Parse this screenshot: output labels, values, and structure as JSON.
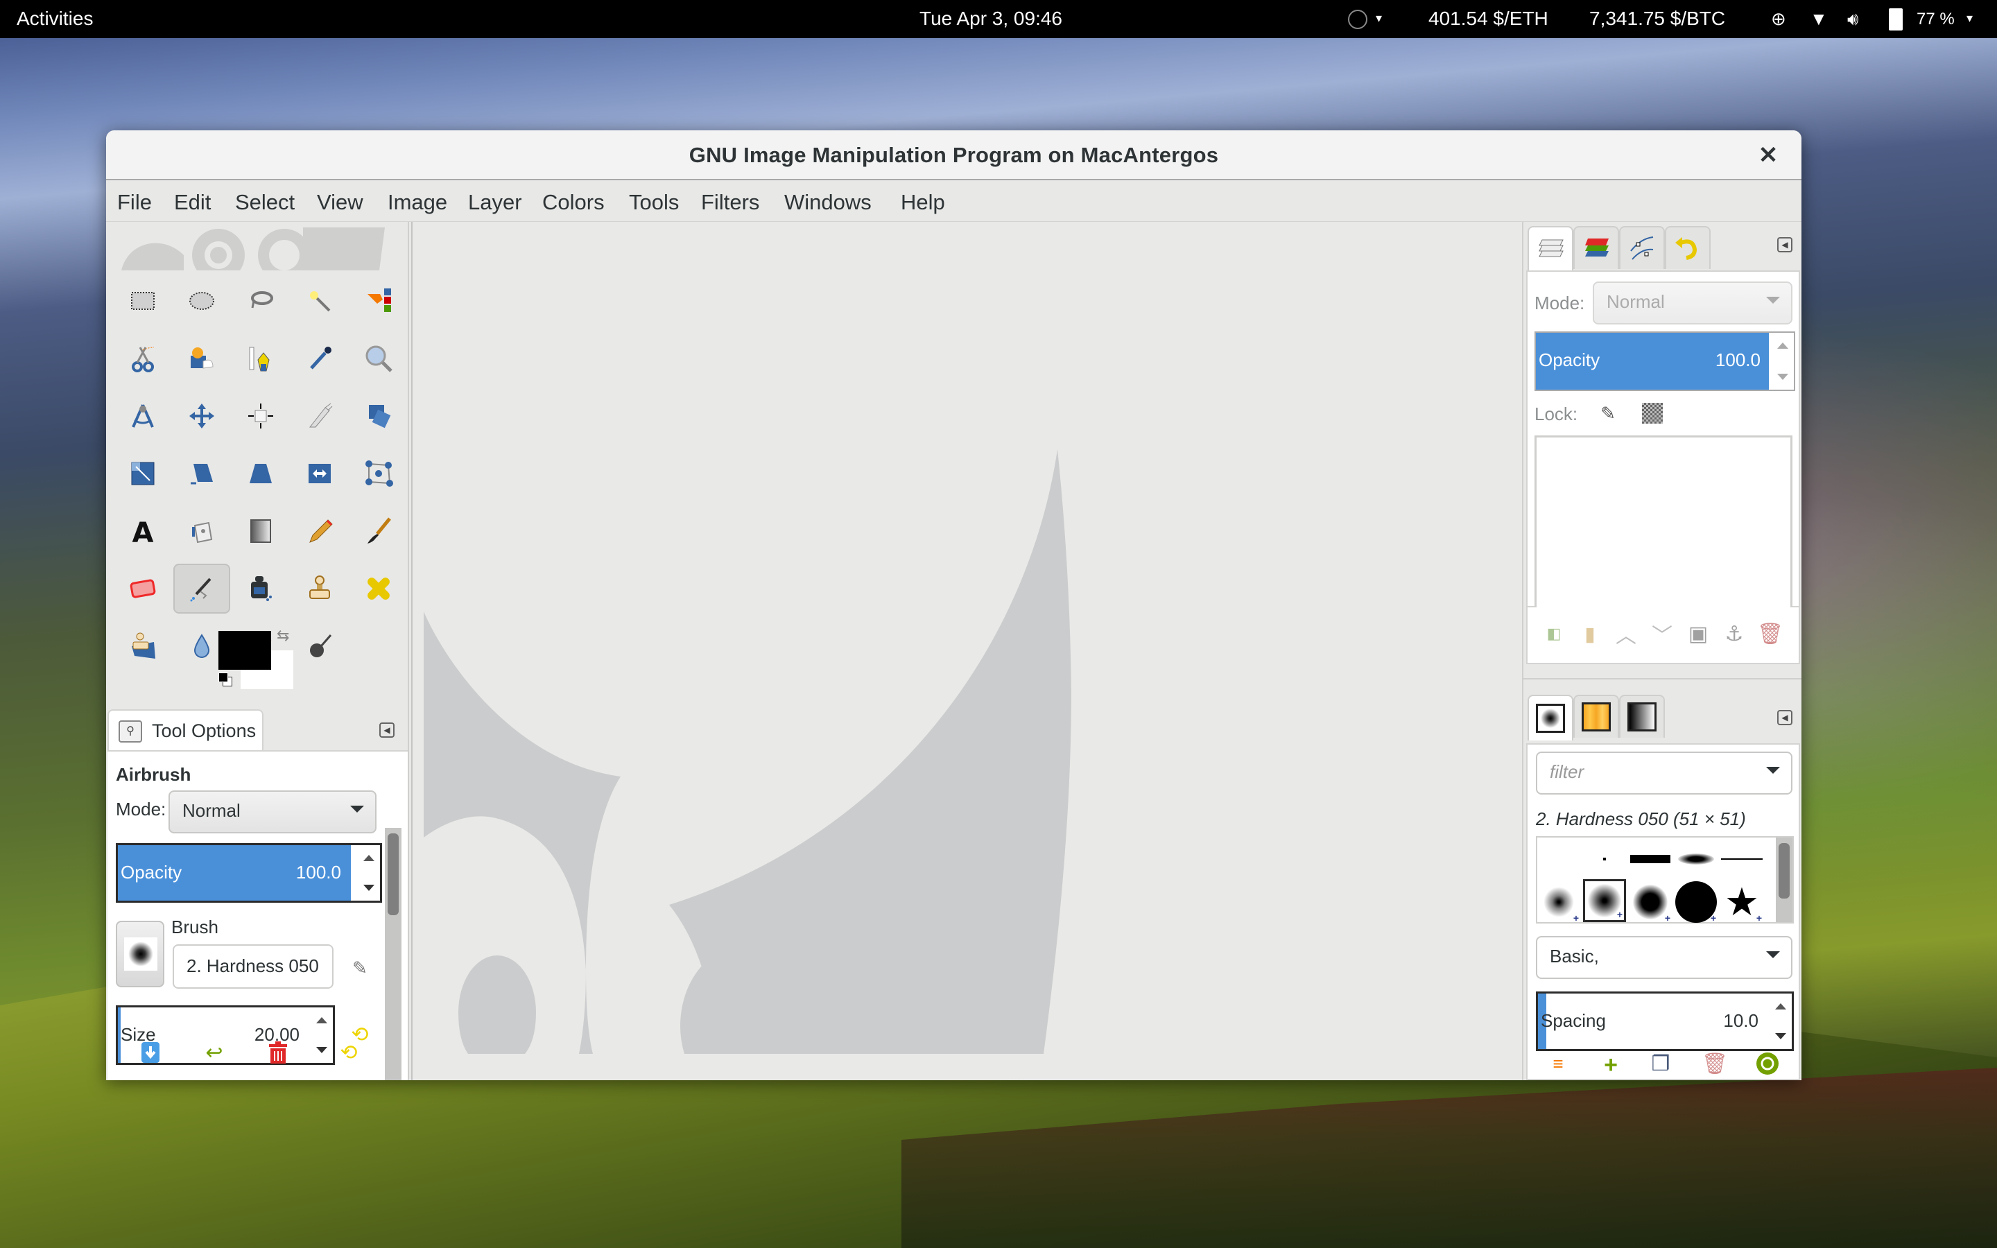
{
  "topbar": {
    "activities": "Activities",
    "clock": "Tue Apr  3, 09:46",
    "eth": "401.54 $/ETH",
    "btc": "7,341.75 $/BTC",
    "battery": "77 %",
    "caret": "▾",
    "icons": [
      "status-circle-icon",
      "accessibility-icon",
      "wifi-icon",
      "volume-icon",
      "battery-icon"
    ]
  },
  "window": {
    "title": "GNU Image Manipulation Program on MacAntergos",
    "close": "✕"
  },
  "menu": [
    "File",
    "Edit",
    "Select",
    "View",
    "Image",
    "Layer",
    "Colors",
    "Tools",
    "Filters",
    "Windows",
    "Help"
  ],
  "toolbox": {
    "tools": [
      "rect-select",
      "ellipse-select",
      "free-select",
      "fuzzy-select",
      "select-by-color",
      "scissors-select",
      "foreground-select",
      "paths",
      "color-picker",
      "zoom",
      "measure",
      "move",
      "alignment",
      "crop",
      "rotate",
      "scale",
      "shear",
      "perspective",
      "flip",
      "cage-transform",
      "text",
      "bucket-fill",
      "blend",
      "pencil",
      "paintbrush",
      "eraser",
      "airbrush",
      "ink",
      "clone",
      "heal",
      "perspective-clone",
      "blur-sharpen",
      "smudge",
      "dodge-burn"
    ],
    "active_tool": "airbrush",
    "foreground_color": "#000000",
    "background_color": "#ffffff"
  },
  "tool_options": {
    "tab_label": "Tool Options",
    "tool_name": "Airbrush",
    "mode_label": "Mode:",
    "mode_value": "Normal",
    "opacity_label": "Opacity",
    "opacity_value": "100.0",
    "opacity_fraction": 1.0,
    "brush_label": "Brush",
    "brush_value": "2. Hardness 050",
    "size_label": "Size",
    "size_value": "20.00",
    "footer_buttons": [
      "save-options",
      "restore-options",
      "delete-options",
      "reset-options"
    ]
  },
  "layers_dock": {
    "tabs": [
      "layers",
      "channels",
      "paths",
      "undo-history"
    ],
    "mode_label": "Mode:",
    "mode_value": "Normal",
    "opacity_label": "Opacity",
    "opacity_value": "100.0",
    "opacity_fraction": 1.0,
    "lock_label": "Lock:",
    "footer_buttons": [
      "new-layer",
      "new-layer-group",
      "raise-layer",
      "lower-layer",
      "duplicate-layer",
      "anchor-layer",
      "delete-layer"
    ]
  },
  "brushes_dock": {
    "tabs": [
      "brushes",
      "patterns",
      "gradients"
    ],
    "filter_placeholder": "filter",
    "selected_brush_info": "2. Hardness 050 (51 × 51)",
    "preset_value": "Basic,",
    "spacing_label": "Spacing",
    "spacing_value": "10.0",
    "spacing_fraction": 0.1,
    "footer_buttons": [
      "edit-brush",
      "new-brush",
      "duplicate-brush",
      "delete-brush",
      "refresh-brushes"
    ]
  },
  "colors": {
    "accent": "#4a90d9",
    "topbar_bg": "#000000",
    "window_bg": "#e8e8e7"
  }
}
